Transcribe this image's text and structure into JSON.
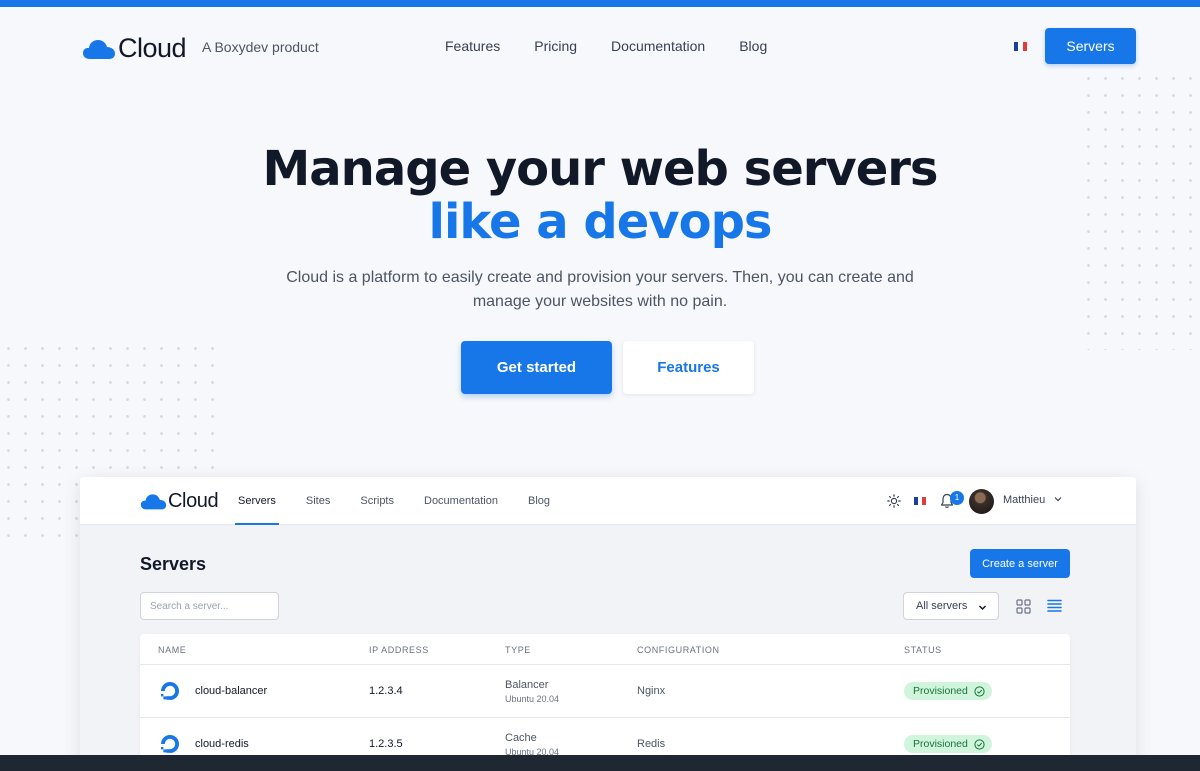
{
  "header": {
    "logo_text": "Cloud",
    "tagline": "A Boxydev product",
    "nav": [
      "Features",
      "Pricing",
      "Documentation",
      "Blog"
    ],
    "cta": "Servers"
  },
  "hero": {
    "title": "Manage your web servers",
    "accent": "like a devops",
    "description": "Cloud is a platform to easily create and provision your servers. Then, you can create and manage your websites with no pain.",
    "primary_button": "Get started",
    "secondary_button": "Features"
  },
  "app": {
    "logo_text": "Cloud",
    "tabs": [
      "Servers",
      "Sites",
      "Scripts",
      "Documentation",
      "Blog"
    ],
    "notification_count": "1",
    "user_name": "Matthieu",
    "page_title": "Servers",
    "create_button": "Create a server",
    "search_placeholder": "Search a server...",
    "filter_value": "All servers",
    "columns": [
      "NAME",
      "IP ADDRESS",
      "TYPE",
      "CONFIGURATION",
      "STATUS"
    ],
    "rows": [
      {
        "name": "cloud-balancer",
        "ip": "1.2.3.4",
        "type": "Balancer",
        "os": "Ubuntu 20.04",
        "config": "Nginx",
        "status": "Provisioned"
      },
      {
        "name": "cloud-redis",
        "ip": "1.2.3.5",
        "type": "Cache",
        "os": "Ubuntu 20.04",
        "config": "Redis",
        "status": "Provisioned"
      }
    ]
  },
  "colors": {
    "accent": "#1877e8",
    "status_bg": "#d1f5dc",
    "status_text": "#17733a"
  },
  "icons": [
    "cloud-logo-icon",
    "france-flag-icon",
    "sun-icon",
    "bell-icon",
    "chevron-down-icon",
    "grid-view-icon",
    "list-view-icon",
    "digitalocean-icon",
    "check-circle-icon"
  ]
}
